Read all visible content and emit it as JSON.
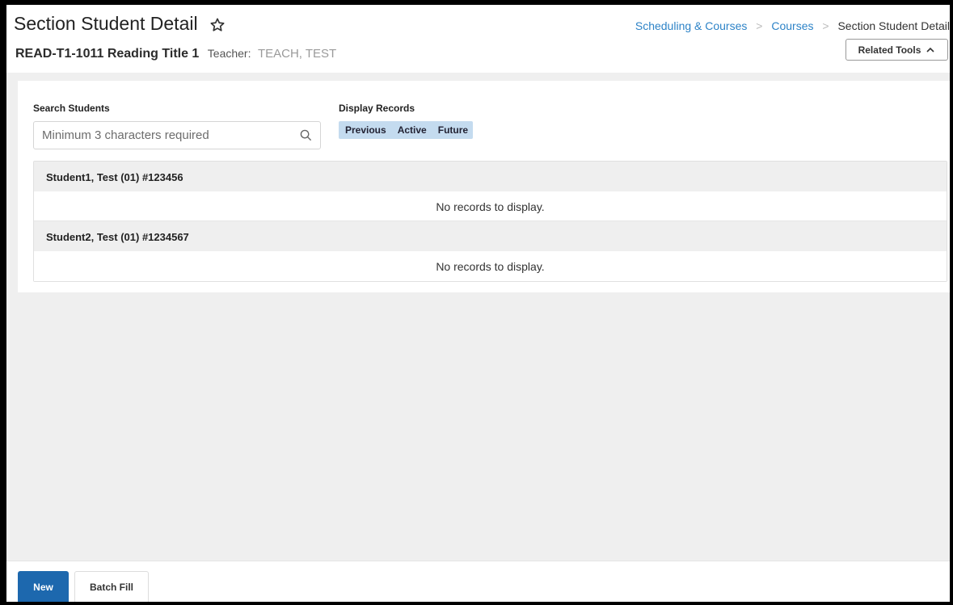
{
  "header": {
    "title": "Section Student Detail",
    "course": "READ-T1-1011 Reading Title 1",
    "teacher_label": "Teacher:",
    "teacher_name": "TEACH, TEST"
  },
  "breadcrumb": {
    "items": [
      "Scheduling & Courses",
      "Courses"
    ],
    "current": "Section Student Detail",
    "separator": ">"
  },
  "related_tools": {
    "label": "Related Tools"
  },
  "search": {
    "label": "Search Students",
    "placeholder": "Minimum 3 characters required",
    "value": ""
  },
  "display_records": {
    "label": "Display Records",
    "options": [
      "Previous",
      "Active",
      "Future"
    ]
  },
  "students": [
    {
      "name": "Student1, Test (01) #123456",
      "empty_text": "No records to display."
    },
    {
      "name": "Student2, Test (01) #1234567",
      "empty_text": "No records to display."
    }
  ],
  "footer": {
    "new_label": "New",
    "batch_fill_label": "Batch Fill"
  },
  "colors": {
    "link": "#2d83c7",
    "primary_button": "#1d68ae",
    "toggle_bg": "#c4dbef",
    "page_bg": "#efefef"
  },
  "icons": {
    "favorite": "star-outline-icon",
    "search": "search-icon",
    "related_tools": "chevron-up-icon"
  }
}
